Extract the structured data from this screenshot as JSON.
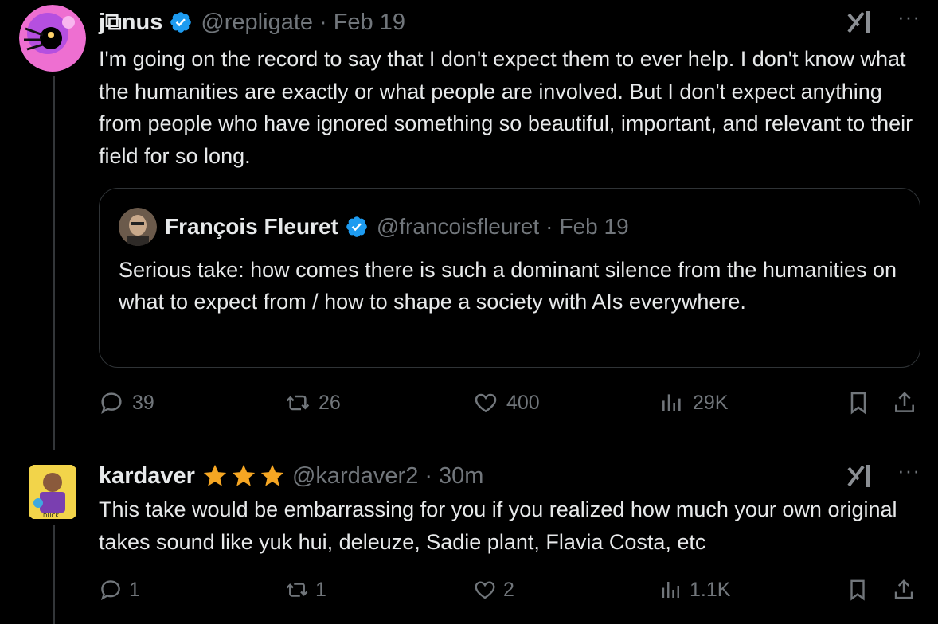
{
  "tweets": [
    {
      "author": {
        "name": "j⧉nus",
        "handle": "@repligate",
        "time": "Feb 19"
      },
      "text": "I'm going on the record to say that I don't expect them to ever help. I don't know what the humanities are exactly or what people are involved. But I don't expect anything from people who have ignored something so beautiful, important, and relevant to their field for so long.",
      "quote": {
        "author": {
          "name": "François Fleuret",
          "handle": "@francoisfleuret",
          "time": "Feb 19"
        },
        "text": "Serious take: how comes there is such a dominant silence from the humanities on what to expect from / how to shape a society with AIs everywhere."
      },
      "stats": {
        "replies": "39",
        "reposts": "26",
        "likes": "400",
        "views": "29K"
      }
    },
    {
      "author": {
        "name": "kardaver",
        "handle": "@kardaver2",
        "time": "30m"
      },
      "text": "This take would be embarrassing for you if you realized how much your own original takes sound like yuk hui, deleuze, Sadie plant, Flavia Costa, etc",
      "stats": {
        "replies": "1",
        "reposts": "1",
        "likes": "2",
        "views": "1.1K"
      }
    }
  ],
  "separator": "·",
  "more_label": "···",
  "colors": {
    "background": "#000000",
    "text": "#e7e9ea",
    "muted": "#71767b",
    "verified": "#1d9bf0",
    "star": "#f5a623"
  }
}
